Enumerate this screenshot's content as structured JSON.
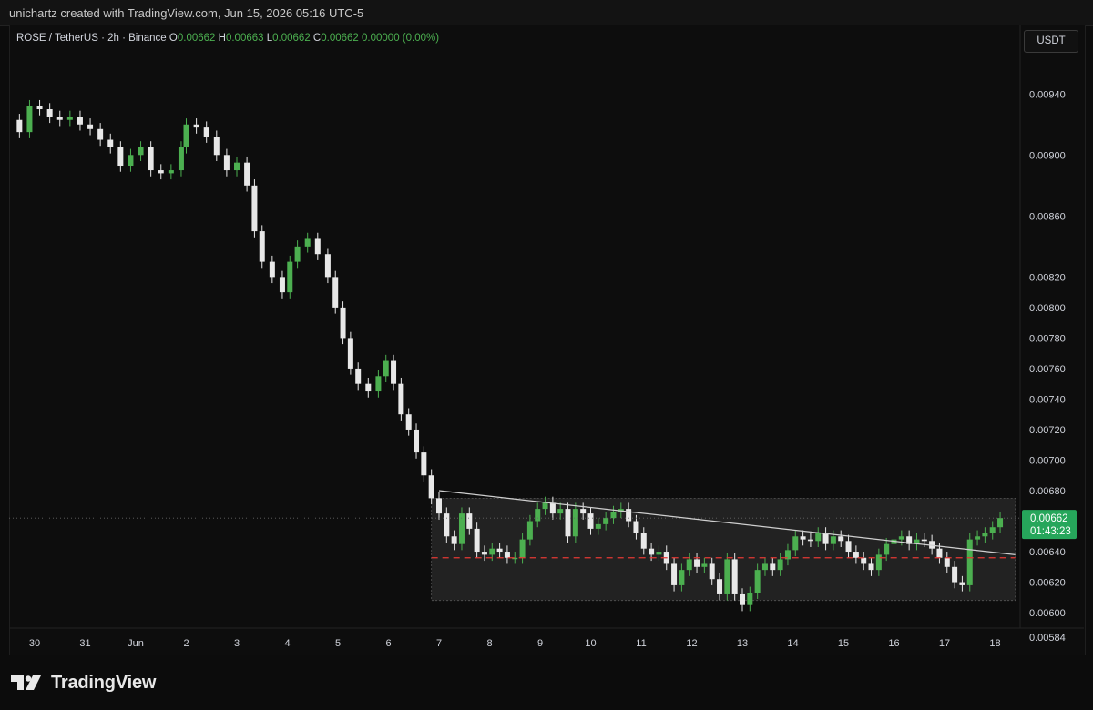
{
  "header": {
    "text": "unichartz created with TradingView.com, Jun 15, 2026 05:16 UTC-5"
  },
  "legend": {
    "symbol": "ROSE / TetherUS · 2h · Binance",
    "o_label": "O",
    "o": "0.00662",
    "h_label": "H",
    "h": "0.00663",
    "l_label": "L",
    "l": "0.00662",
    "c_label": "C",
    "c": "0.00662",
    "change": "0.00000 (0.00%)"
  },
  "currency_button": "USDT",
  "price_badge": {
    "price": "0.00662",
    "countdown": "01:43:23"
  },
  "footer": {
    "brand": "TradingView"
  },
  "colors": {
    "up": "#4caf50",
    "down": "#e8e8e8",
    "badge": "#26a65b",
    "support": "#e53935",
    "trendline": "#cfcfcf",
    "zone": "#2a2a2a"
  },
  "chart_data": {
    "type": "candlestick",
    "y_ticks": [
      "0.00940",
      "0.00900",
      "0.00860",
      "0.00820",
      "0.00800",
      "0.00780",
      "0.00760",
      "0.00740",
      "0.00720",
      "0.00700",
      "0.00680",
      "0.00640",
      "0.00620",
      "0.00600",
      "0.00584"
    ],
    "x_ticks": [
      "30",
      "31",
      "Jun",
      "2",
      "3",
      "4",
      "5",
      "6",
      "7",
      "8",
      "9",
      "10",
      "11",
      "12",
      "13",
      "14",
      "15",
      "16",
      "17",
      "18"
    ],
    "ylim": [
      0.00572,
      0.00967
    ],
    "series": [
      {
        "day": 29.7,
        "close": 0.00915
      },
      {
        "day": 29.9,
        "close": 0.00932
      },
      {
        "day": 30.1,
        "close": 0.0093
      },
      {
        "day": 30.3,
        "close": 0.00925
      },
      {
        "day": 30.5,
        "close": 0.00923
      },
      {
        "day": 30.7,
        "close": 0.00925
      },
      {
        "day": 30.9,
        "close": 0.0092
      },
      {
        "day": 31.1,
        "close": 0.00917
      },
      {
        "day": 31.3,
        "close": 0.0091
      },
      {
        "day": 31.5,
        "close": 0.00905
      },
      {
        "day": 31.7,
        "close": 0.00893
      },
      {
        "day": 31.9,
        "close": 0.009
      },
      {
        "day": 32.1,
        "close": 0.00905
      },
      {
        "day": 32.3,
        "close": 0.0089
      },
      {
        "day": 32.5,
        "close": 0.00888
      },
      {
        "day": 32.7,
        "close": 0.0089
      },
      {
        "day": 32.9,
        "close": 0.00905
      },
      {
        "day": 33.0,
        "close": 0.0092
      },
      {
        "day": 33.2,
        "close": 0.00918
      },
      {
        "day": 33.4,
        "close": 0.00912
      },
      {
        "day": 33.6,
        "close": 0.009
      },
      {
        "day": 33.8,
        "close": 0.0089
      },
      {
        "day": 34.0,
        "close": 0.00895
      },
      {
        "day": 34.2,
        "close": 0.0088
      },
      {
        "day": 34.35,
        "close": 0.0085
      },
      {
        "day": 34.5,
        "close": 0.0083
      },
      {
        "day": 34.7,
        "close": 0.0082
      },
      {
        "day": 34.9,
        "close": 0.0081
      },
      {
        "day": 35.05,
        "close": 0.0083
      },
      {
        "day": 35.2,
        "close": 0.0084
      },
      {
        "day": 35.4,
        "close": 0.00845
      },
      {
        "day": 35.6,
        "close": 0.00835
      },
      {
        "day": 35.8,
        "close": 0.0082
      },
      {
        "day": 35.95,
        "close": 0.008
      },
      {
        "day": 36.1,
        "close": 0.0078
      },
      {
        "day": 36.25,
        "close": 0.0076
      },
      {
        "day": 36.4,
        "close": 0.0075
      },
      {
        "day": 36.6,
        "close": 0.00745
      },
      {
        "day": 36.8,
        "close": 0.00755
      },
      {
        "day": 36.95,
        "close": 0.00765
      },
      {
        "day": 37.1,
        "close": 0.0075
      },
      {
        "day": 37.25,
        "close": 0.0073
      },
      {
        "day": 37.4,
        "close": 0.0072
      },
      {
        "day": 37.55,
        "close": 0.00705
      },
      {
        "day": 37.7,
        "close": 0.0069
      },
      {
        "day": 37.85,
        "close": 0.00675
      },
      {
        "day": 38.0,
        "close": 0.00665
      },
      {
        "day": 38.15,
        "close": 0.0065
      },
      {
        "day": 38.3,
        "close": 0.00645
      },
      {
        "day": 38.45,
        "close": 0.00665
      },
      {
        "day": 38.6,
        "close": 0.00655
      },
      {
        "day": 38.75,
        "close": 0.0064
      },
      {
        "day": 38.9,
        "close": 0.00638
      },
      {
        "day": 39.05,
        "close": 0.00642
      },
      {
        "day": 39.2,
        "close": 0.0064
      },
      {
        "day": 39.35,
        "close": 0.00636
      },
      {
        "day": 39.5,
        "close": 0.00636
      },
      {
        "day": 39.65,
        "close": 0.00648
      },
      {
        "day": 39.8,
        "close": 0.0066
      },
      {
        "day": 39.95,
        "close": 0.00668
      },
      {
        "day": 40.1,
        "close": 0.00672
      },
      {
        "day": 40.25,
        "close": 0.00665
      },
      {
        "day": 40.4,
        "close": 0.00668
      },
      {
        "day": 40.55,
        "close": 0.0065
      },
      {
        "day": 40.7,
        "close": 0.00668
      },
      {
        "day": 40.85,
        "close": 0.00665
      },
      {
        "day": 41.0,
        "close": 0.00655
      },
      {
        "day": 41.15,
        "close": 0.00658
      },
      {
        "day": 41.3,
        "close": 0.00662
      },
      {
        "day": 41.45,
        "close": 0.00666
      },
      {
        "day": 41.6,
        "close": 0.00668
      },
      {
        "day": 41.75,
        "close": 0.0066
      },
      {
        "day": 41.9,
        "close": 0.00652
      },
      {
        "day": 42.05,
        "close": 0.00642
      },
      {
        "day": 42.2,
        "close": 0.00638
      },
      {
        "day": 42.35,
        "close": 0.0064
      },
      {
        "day": 42.5,
        "close": 0.00632
      },
      {
        "day": 42.65,
        "close": 0.00618
      },
      {
        "day": 42.8,
        "close": 0.00628
      },
      {
        "day": 42.95,
        "close": 0.00635
      },
      {
        "day": 43.1,
        "close": 0.0063
      },
      {
        "day": 43.25,
        "close": 0.00632
      },
      {
        "day": 43.4,
        "close": 0.00622
      },
      {
        "day": 43.55,
        "close": 0.00612
      },
      {
        "day": 43.7,
        "close": 0.00635
      },
      {
        "day": 43.85,
        "close": 0.00612
      },
      {
        "day": 44.0,
        "close": 0.00605
      },
      {
        "day": 44.15,
        "close": 0.00613
      },
      {
        "day": 44.3,
        "close": 0.00628
      },
      {
        "day": 44.45,
        "close": 0.00632
      },
      {
        "day": 44.6,
        "close": 0.00628
      },
      {
        "day": 44.75,
        "close": 0.00635
      },
      {
        "day": 44.9,
        "close": 0.00641
      },
      {
        "day": 45.05,
        "close": 0.0065
      },
      {
        "day": 45.2,
        "close": 0.00648
      },
      {
        "day": 45.35,
        "close": 0.00647
      },
      {
        "day": 45.5,
        "close": 0.00652
      },
      {
        "day": 45.65,
        "close": 0.00645
      },
      {
        "day": 45.8,
        "close": 0.0065
      },
      {
        "day": 45.95,
        "close": 0.00647
      },
      {
        "day": 46.1,
        "close": 0.0064
      },
      {
        "day": 46.25,
        "close": 0.00636
      },
      {
        "day": 46.4,
        "close": 0.00632
      },
      {
        "day": 46.55,
        "close": 0.00628
      },
      {
        "day": 46.7,
        "close": 0.00638
      },
      {
        "day": 46.85,
        "close": 0.00645
      },
      {
        "day": 47.0,
        "close": 0.00648
      },
      {
        "day": 47.15,
        "close": 0.0065
      },
      {
        "day": 47.3,
        "close": 0.00645
      },
      {
        "day": 47.45,
        "close": 0.00648
      },
      {
        "day": 47.6,
        "close": 0.00647
      },
      {
        "day": 47.75,
        "close": 0.00642
      },
      {
        "day": 47.9,
        "close": 0.00636
      },
      {
        "day": 48.05,
        "close": 0.0063
      },
      {
        "day": 48.2,
        "close": 0.0062
      },
      {
        "day": 48.35,
        "close": 0.00618
      },
      {
        "day": 48.5,
        "close": 0.00648
      },
      {
        "day": 48.65,
        "close": 0.0065
      },
      {
        "day": 48.8,
        "close": 0.00652
      },
      {
        "day": 48.95,
        "close": 0.00656
      },
      {
        "day": 49.1,
        "close": 0.00662
      }
    ],
    "trendline": {
      "from": {
        "day": 38.0,
        "value": 0.0068
      },
      "to": {
        "day": 49.4,
        "value": 0.00638
      }
    },
    "support_level": 0.00636,
    "range_box": {
      "x_from": 37.85,
      "x_to": 49.4,
      "y_from": 0.00608,
      "y_to": 0.00675
    },
    "last_price_line": 0.00662
  }
}
